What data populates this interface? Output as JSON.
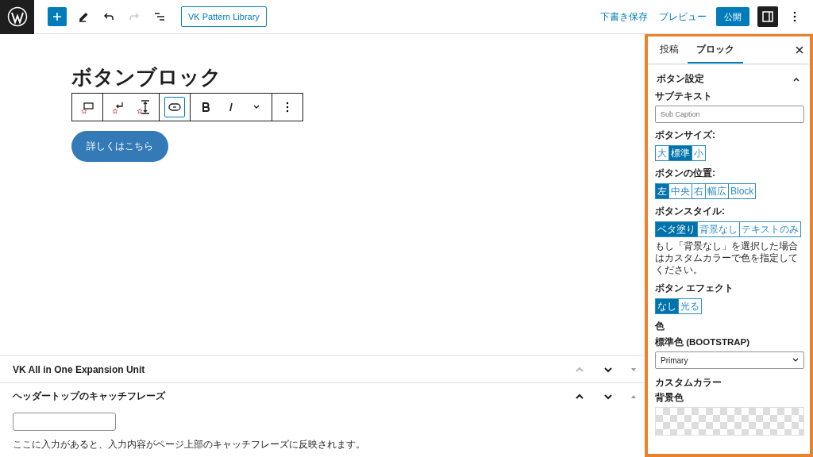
{
  "topbar": {
    "pattern_library": "VK Pattern Library",
    "save_draft": "下書き保存",
    "preview": "プレビュー",
    "publish": "公開",
    "settings_open": true
  },
  "editor": {
    "heading": "ボタンブロック",
    "button_label": "詳しくはこちら"
  },
  "block_toolbar": {
    "link_active": true
  },
  "metaboxes": [
    {
      "title": "VK All in One Expansion Unit",
      "expanded": false,
      "can_move_up": false
    },
    {
      "title": "ヘッダートップのキャッチフレーズ",
      "expanded": true,
      "can_move_up": true,
      "help": "ここに入力があると、入力内容がページ上部のキャッチフレーズに反映されます。"
    }
  ],
  "sidebar": {
    "tabs": [
      {
        "label": "投稿",
        "selected": false
      },
      {
        "label": "ブロック",
        "selected": true
      }
    ],
    "panel_title": "ボタン設定",
    "panel_expanded": true,
    "subtext_label": "サブテキスト",
    "subtext_placeholder": "Sub Caption",
    "groups": [
      {
        "label": "ボタンサイズ:",
        "options": [
          {
            "label": "大",
            "selected": false
          },
          {
            "label": "標準",
            "selected": true
          },
          {
            "label": "小",
            "selected": false
          }
        ]
      },
      {
        "label": "ボタンの位置:",
        "options": [
          {
            "label": "左",
            "selected": true
          },
          {
            "label": "中央",
            "selected": false
          },
          {
            "label": "右",
            "selected": false
          },
          {
            "label": "幅広",
            "selected": false
          },
          {
            "label": "Block",
            "selected": false
          }
        ]
      },
      {
        "label": "ボタンスタイル:",
        "options": [
          {
            "label": "ベタ塗り",
            "selected": true
          },
          {
            "label": "背景なし",
            "selected": false
          },
          {
            "label": "テキストのみ",
            "selected": false
          }
        ],
        "note": "もし「背景なし」を選択した場合はカスタムカラーで色を指定してください。"
      },
      {
        "label": "ボタン エフェクト",
        "options": [
          {
            "label": "なし",
            "selected": true
          },
          {
            "label": "光る",
            "selected": false
          }
        ]
      }
    ],
    "color_heading": "色",
    "standard_color_label": "標準色 (BOOTSTRAP)",
    "standard_color_value": "Primary",
    "custom_color_label": "カスタムカラー",
    "background_label": "背景色"
  }
}
